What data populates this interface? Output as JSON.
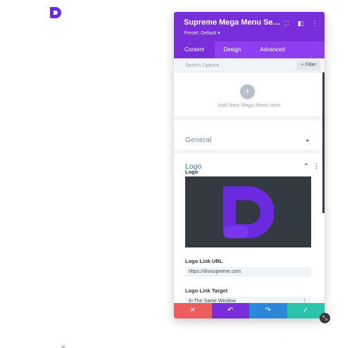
{
  "colors": {
    "header_purple": "#7a2ddb",
    "tab_purple": "#8c3ef0",
    "brand_logo": "#6c2ae0",
    "section_active_blue": "#2e7fb8",
    "discard_red": "#ef5c5c",
    "undo_purple": "#7a2ddb",
    "redo_blue": "#2b87da",
    "save_green": "#29c4a9",
    "annotation_arrow": "#e02424"
  },
  "modal": {
    "title": "Supreme Mega Menu Setti...",
    "preset": "Preset: Default ▾",
    "icons": [
      "expand-icon",
      "sidebar-icon",
      "more-options-icon"
    ]
  },
  "tabs": [
    {
      "label": "Content",
      "active": true
    },
    {
      "label": "Design",
      "active": false
    },
    {
      "label": "Advanced",
      "active": false
    }
  ],
  "search": {
    "placeholder": "Search Options",
    "filter_label": "+ Filter"
  },
  "add_item": {
    "icon": "plus-icon",
    "label": "Add New Mega Menu Item"
  },
  "sections": {
    "general": {
      "title": "General",
      "expanded": false
    },
    "logo": {
      "title": "Logo",
      "expanded": true
    }
  },
  "logo_fields": {
    "logo_label": "Logo",
    "link_url_label": "Logo Link URL",
    "link_url_value": "https://divisupreme.com",
    "link_target_label": "Logo Link Target",
    "link_target_value": "In The Same Window"
  },
  "footer": {
    "discard": "✕",
    "undo": "↶",
    "redo": "↷",
    "save": "✓"
  }
}
